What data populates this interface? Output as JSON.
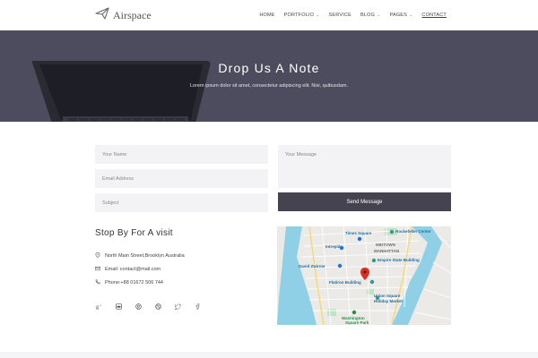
{
  "brand": {
    "name": "Airspace"
  },
  "nav": {
    "items": [
      {
        "label": "HOME",
        "dropdown": false
      },
      {
        "label": "PORTFOLIO",
        "dropdown": true
      },
      {
        "label": "SERVICE",
        "dropdown": false
      },
      {
        "label": "BLOG",
        "dropdown": true
      },
      {
        "label": "PAGES",
        "dropdown": true
      },
      {
        "label": "CONTACT",
        "dropdown": false,
        "active": true
      }
    ]
  },
  "hero": {
    "title": "Drop Us A Note",
    "subtitle": "Lorem ipsum dolor sit amet, consectetur adipiscing elit. Nisi, quibusdam."
  },
  "form": {
    "name_placeholder": "Your Name",
    "email_placeholder": "Email Address",
    "subject_placeholder": "Subject",
    "message_placeholder": "Your Message",
    "send_label": "Send Message"
  },
  "visit": {
    "title": "Stop By For A visit",
    "address": "North Main Street,Brooklyn Australia",
    "email": "Email: contact@mail.com",
    "phone": "Phone:+88 01672 506 744"
  },
  "socials": [
    "google-plus-icon",
    "linkedin-icon",
    "pinterest-icon",
    "dribbble-icon",
    "twitter-icon",
    "facebook-icon"
  ],
  "map": {
    "labels": {
      "times_square": "Times Square",
      "rockefeller": "Rockefeller Center",
      "intrepid": "Intrepid",
      "midtown": "MIDTOWN",
      "manhattan": "MANHATTAN",
      "empire": "Empire State Building",
      "zwirner": "David Zwirner",
      "flatiron": "Flatiron Building",
      "union_square": "Union Square",
      "holiday": "Holiday Market",
      "washington": "Washington",
      "square_park": "Square Park"
    }
  },
  "colors": {
    "hero_bg": "#4d4c5e",
    "button_bg": "#45434f",
    "field_bg": "#f3f3f5",
    "pin": "#d93025"
  }
}
